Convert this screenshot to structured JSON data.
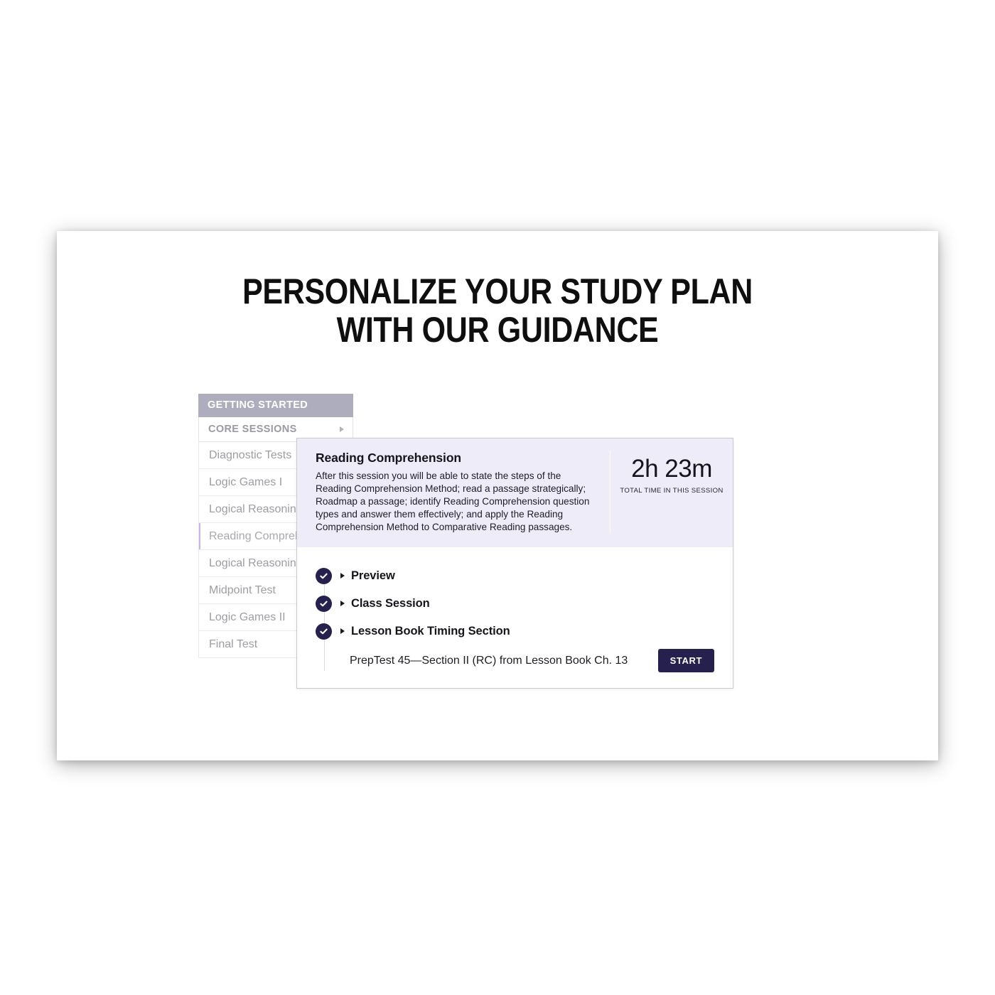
{
  "slide": {
    "title_line1": "PERSONALIZE YOUR STUDY PLAN",
    "title_line2": "WITH OUR GUIDANCE"
  },
  "sidebar": {
    "header_label": "GETTING STARTED",
    "core_sessions_label": "CORE SESSIONS",
    "items": [
      {
        "label": "Diagnostic Tests",
        "active": false
      },
      {
        "label": "Logic Games I",
        "active": false
      },
      {
        "label": "Logical Reasoning I",
        "active": false
      },
      {
        "label": "Reading Comprehension",
        "active": true
      },
      {
        "label": "Logical Reasoning II",
        "active": false
      },
      {
        "label": "Midpoint Test",
        "active": false
      },
      {
        "label": "Logic Games II",
        "active": false
      },
      {
        "label": "Final Test",
        "active": false
      }
    ]
  },
  "panel": {
    "session_title": "Reading Comprehension",
    "session_description": "After this session you will be able to state the steps of the Reading Comprehension Method; read a passage strategically; Roadmap a passage; identify Reading Comprehension question types and answer them effectively; and apply the Reading Comprehension Method to Comparative Reading passages.",
    "total_time_value": "2h 23m",
    "total_time_label": "TOTAL TIME IN THIS SESSION",
    "checklist": [
      {
        "label": "Preview",
        "completed": true
      },
      {
        "label": "Class Session",
        "completed": true
      },
      {
        "label": "Lesson Book Timing Section",
        "completed": true
      }
    ],
    "assignment_text": "PrepTest 45—Section II (RC) from Lesson Book Ch. 13",
    "start_label": "START"
  },
  "colors": {
    "accent_navy": "#26204f",
    "header_lavender": "#eeecf9",
    "sidebar_header_grey": "#aeadbe",
    "active_accent_purple": "#c8b6e8"
  }
}
